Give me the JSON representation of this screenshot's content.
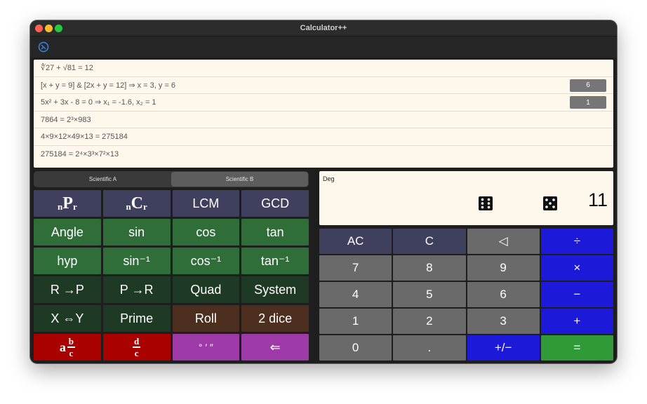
{
  "window": {
    "title": "Calculator++"
  },
  "colors": {
    "purple_key": "#3f3f5e",
    "green_key": "#2f6e38",
    "dark_green_key": "#1f3a24",
    "brown_key": "#4d2f1f",
    "red_key": "#a90000",
    "magenta_key": "#9e3aa8",
    "gray_key": "#6a6a6a",
    "blue_key": "#1d19d9",
    "equals_key": "#2f9a37",
    "paper": "#fdf7ec"
  },
  "history": [
    {
      "text": "∜27 + √81 = 12",
      "badge": ""
    },
    {
      "text": "[x + y = 9]  &  [2x + y = 12] ⇒ x = 3, y = 6",
      "badge": "6"
    },
    {
      "text": "5x² + 3x - 8 = 0      ⇒      x₁ = -1.6, x₂ = 1",
      "badge": "1"
    },
    {
      "text": "7864 = 2³×983",
      "badge": ""
    },
    {
      "text": "4×9×12×49×13 = 275184",
      "badge": ""
    },
    {
      "text": "275184 = 2⁴×3³×7²×13",
      "badge": ""
    }
  ],
  "tabs": [
    {
      "label": "Scientific A",
      "active": false
    },
    {
      "label": "Scientific B",
      "active": true
    }
  ],
  "sci_keys": {
    "npr": {
      "pre": "n",
      "main": "P",
      "post": "r"
    },
    "ncr": {
      "pre": "n",
      "main": "C",
      "post": "r"
    },
    "lcm": "LCM",
    "gcd": "GCD",
    "angle": "Angle",
    "sin": "sin",
    "cos": "cos",
    "tan": "tan",
    "hyp": "hyp",
    "asin": "sin⁻¹",
    "acos": "cos⁻¹",
    "atan": "tan⁻¹",
    "r2p": "R →P",
    "p2r": "P →R",
    "quad": "Quad",
    "system": "System",
    "swap": "X ⇔Y",
    "prime": "Prime",
    "roll": "Roll",
    "two_dice": "2 dice",
    "mixed_fraction": {
      "whole": "a",
      "num": "b",
      "den": "c"
    },
    "fraction": {
      "num": "d",
      "den": "c"
    },
    "dms": "° ′ ″",
    "back_arrow": "⇐"
  },
  "display": {
    "mode": "Deg",
    "dice_left_icon": "dice-six-icon",
    "dice_right_icon": "dice-five-icon",
    "value": "11"
  },
  "num_keys": {
    "ac": "AC",
    "c": "C",
    "backspace": "◁",
    "divide": "÷",
    "seven": "7",
    "eight": "8",
    "nine": "9",
    "multiply": "×",
    "four": "4",
    "five": "5",
    "six": "6",
    "minus": "−",
    "one": "1",
    "two": "2",
    "three": "3",
    "plus": "+",
    "zero": "0",
    "dot": ".",
    "plus_minus": "+/−",
    "equals": "="
  }
}
